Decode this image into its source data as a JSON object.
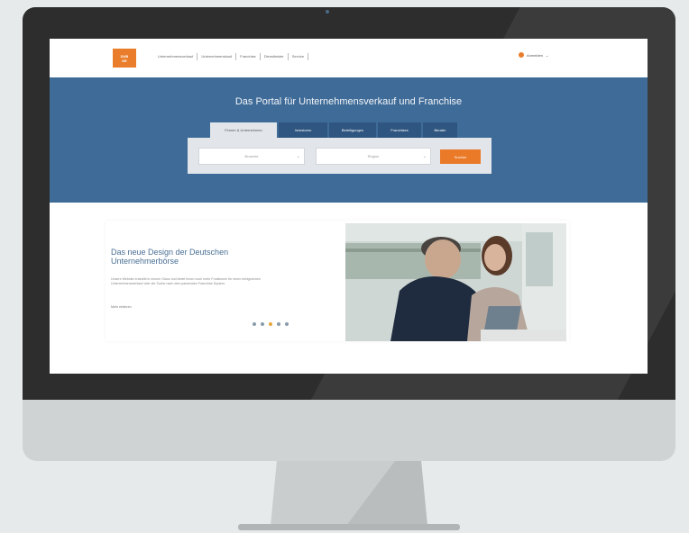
{
  "navbar": {
    "logo_lines": [
      "DUB",
      "DE"
    ],
    "menu": [
      "Unternehmensverkauf",
      "Unternehmenskauf",
      "Franchise",
      "Dienstleister",
      "Service"
    ],
    "login": "Anmelden"
  },
  "hero": {
    "title": "Das Portal für Unternehmensverkauf und Franchise",
    "tabs": [
      "Firmen & Unternehmen",
      "Investoren",
      "Beteiligungen",
      "Franchises",
      "Berater"
    ],
    "select_1": "Branche",
    "select_2": "Region",
    "search_button": "Suchen"
  },
  "feature": {
    "title": "Das neue Design der Deutschen Unternehmerbörse",
    "text": "Unsere Website erstrahlt in neuem Glanz und bietet Ihnen noch mehr Funktionen für einen erfolgreichen Unternehmensverkauf oder die Suche nach dem passenden Franchise-System.",
    "link": "Mehr erfahren",
    "slide_dots": 5,
    "active_dot": 3
  },
  "colors": {
    "brand_orange": "#e97d2b",
    "hero_blue": "#3f6b98",
    "bezel": "#2d2d2d"
  }
}
